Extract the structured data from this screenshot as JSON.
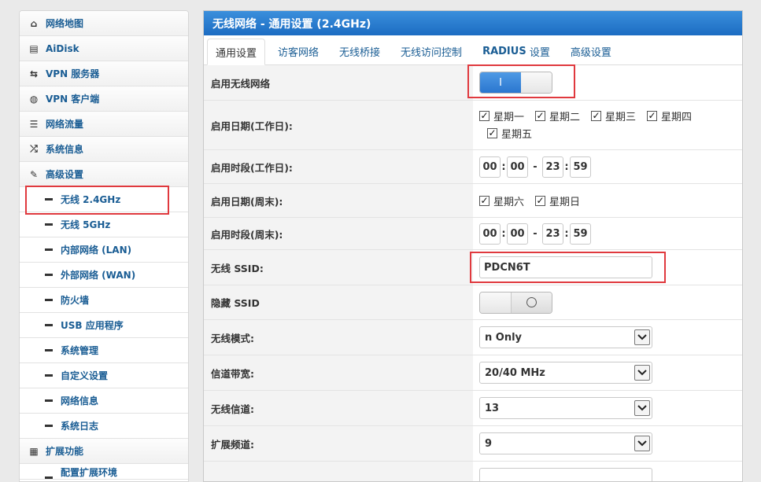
{
  "sidebar": {
    "items": [
      {
        "label": "网络地图",
        "icon": "home-icon",
        "glyph": "⌂"
      },
      {
        "label": "AiDisk",
        "icon": "disk-icon",
        "glyph": "▤"
      },
      {
        "label": "VPN 服务器",
        "icon": "swap-icon",
        "glyph": "⇆"
      },
      {
        "label": "VPN 客户端",
        "icon": "globe-icon",
        "glyph": "◍"
      },
      {
        "label": "网络流量",
        "icon": "list-icon",
        "glyph": "☰"
      },
      {
        "label": "系统信息",
        "icon": "shuffle-icon",
        "glyph": "⤮"
      },
      {
        "label": "高级设置",
        "icon": "wrench-icon",
        "glyph": "✎"
      }
    ],
    "sub_items": [
      {
        "label": "无线 2.4GHz"
      },
      {
        "label": "无线 5GHz"
      },
      {
        "label": "内部网络 (LAN)"
      },
      {
        "label": "外部网络 (WAN)"
      },
      {
        "label": "防火墙"
      },
      {
        "label": "USB 应用程序"
      },
      {
        "label": "系统管理"
      },
      {
        "label": "自定义设置"
      },
      {
        "label": "网络信息"
      },
      {
        "label": "系统日志"
      }
    ],
    "extra": {
      "label": "扩展功能",
      "icon": "grid-icon",
      "glyph": "▦"
    },
    "cut_label": "配置扩展环境"
  },
  "main": {
    "title": "无线网络 - 通用设置 (2.4GHz)",
    "tabs": [
      {
        "label": "通用设置"
      },
      {
        "label": "访客网络"
      },
      {
        "label": "无线桥接"
      },
      {
        "label": "无线访问控制"
      },
      {
        "label_bold": "RADIUS",
        "label_rest": " 设置"
      },
      {
        "label": "高级设置"
      }
    ],
    "enable_wifi": {
      "label": "启用无线网络",
      "value": true,
      "glyph": "I"
    },
    "weekday_dates": {
      "label": "启用日期(工作日):",
      "days": [
        "星期一",
        "星期二",
        "星期三",
        "星期四",
        "星期五"
      ],
      "check": "✓"
    },
    "weekday_time": {
      "label": "启用时段(工作日):",
      "start_h": "00",
      "start_m": "00",
      "end_h": "23",
      "end_m": "59",
      "colon": ":",
      "dash": "-"
    },
    "weekend_dates": {
      "label": "启用日期(周末):",
      "days": [
        "星期六",
        "星期日"
      ],
      "check": "✓"
    },
    "weekend_time": {
      "label": "启用时段(周末):",
      "start_h": "00",
      "start_m": "00",
      "end_h": "23",
      "end_m": "59",
      "colon": ":",
      "dash": "-"
    },
    "ssid": {
      "label": "无线 SSID:",
      "value": "PDCN6T"
    },
    "hide_ssid": {
      "label": "隐藏 SSID",
      "value": false
    },
    "wireless_mode": {
      "label": "无线模式:",
      "value": "n Only"
    },
    "bandwidth": {
      "label": "信道带宽:",
      "value": "20/40 MHz"
    },
    "channel": {
      "label": "无线信道:",
      "value": "13"
    },
    "ext_channel": {
      "label": "扩展频道:",
      "value": "9"
    }
  },
  "colors": {
    "highlight": "#e0393e",
    "accent": "#2a76cf",
    "link": "#1a5d94"
  }
}
